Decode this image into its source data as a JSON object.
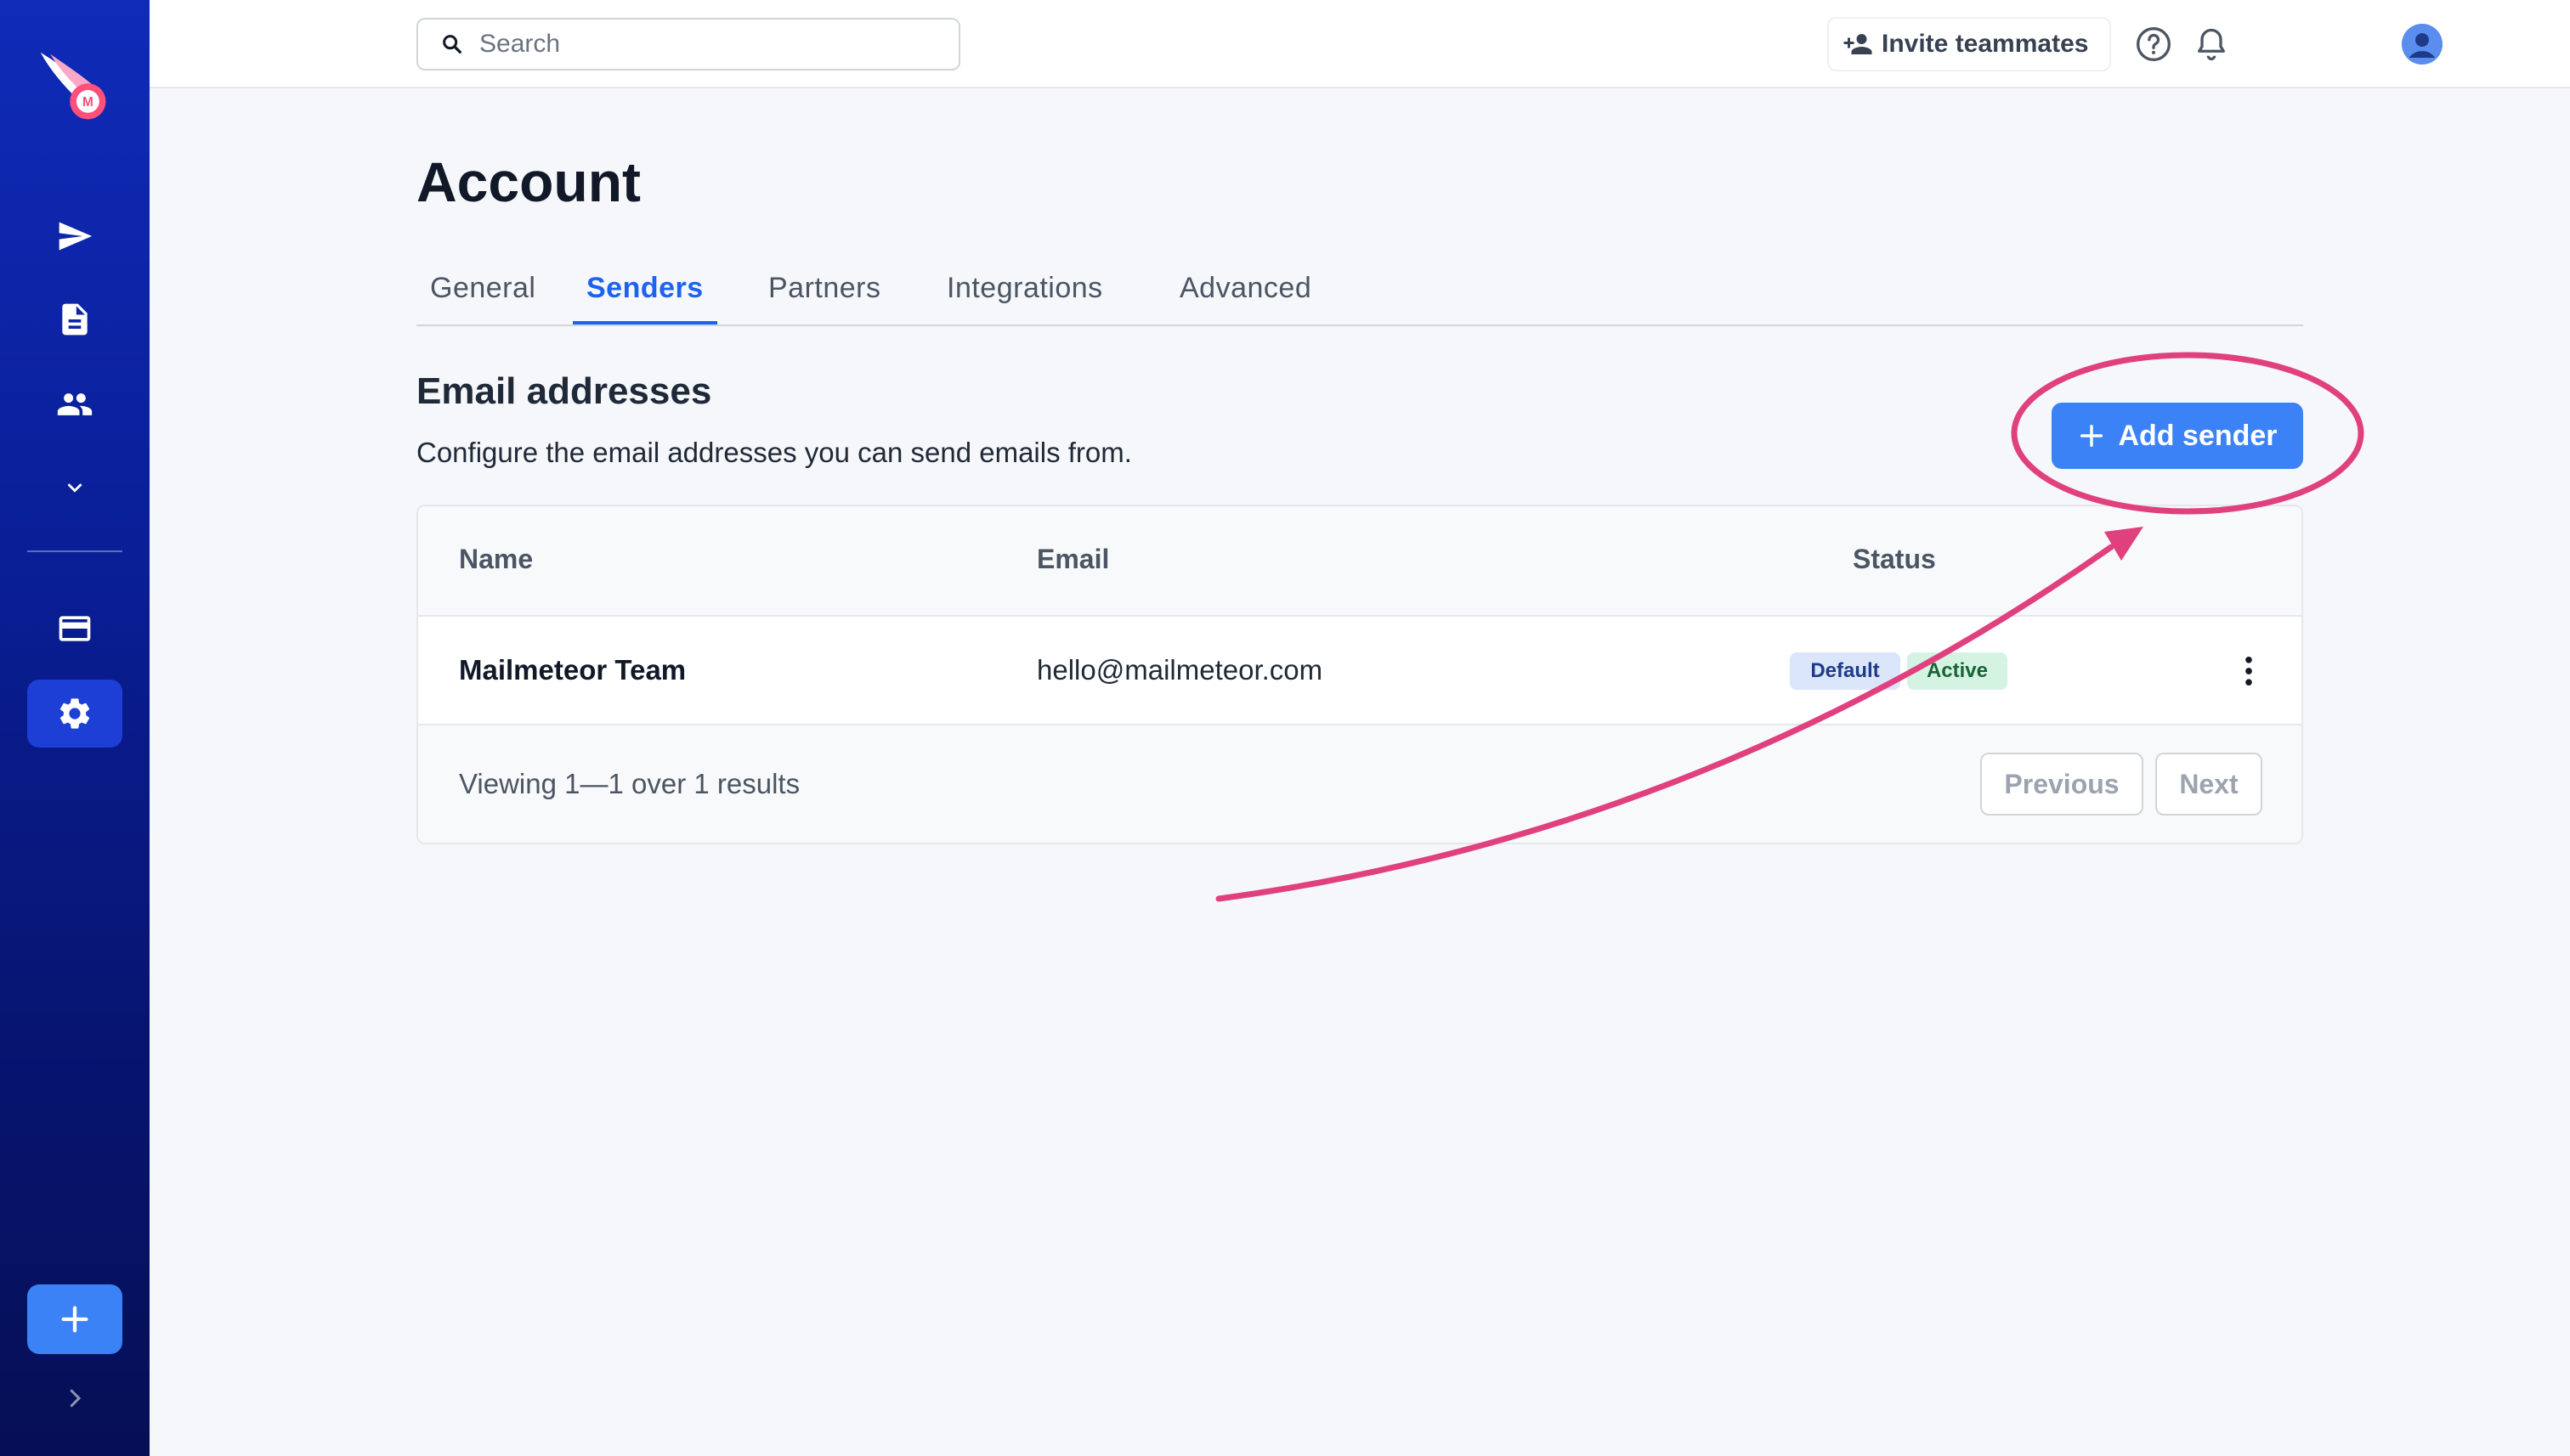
{
  "colors": {
    "sidebar": "#0a1f9a",
    "accent": "#3b82f6",
    "tab_active": "#1d62f0",
    "annotation": "#e0407e"
  },
  "topbar": {
    "search_placeholder": "Search",
    "invite_label": "Invite teammates"
  },
  "sidebar": {
    "items": [
      {
        "icon": "send-icon"
      },
      {
        "icon": "document-icon"
      },
      {
        "icon": "people-icon"
      },
      {
        "icon": "chevron-down-icon"
      },
      {
        "icon": "credit-card-icon"
      },
      {
        "icon": "gear-icon",
        "active": true
      }
    ]
  },
  "page": {
    "title": "Account",
    "tabs": [
      {
        "label": "General"
      },
      {
        "label": "Senders",
        "active": true
      },
      {
        "label": "Partners"
      },
      {
        "label": "Integrations"
      },
      {
        "label": "Advanced"
      }
    ]
  },
  "section": {
    "title": "Email addresses",
    "description": "Configure the email addresses you can send emails from.",
    "add_button": "Add sender"
  },
  "table": {
    "columns": [
      "Name",
      "Email",
      "Status"
    ],
    "rows": [
      {
        "name": "Mailmeteor Team",
        "email": "hello@mailmeteor.com",
        "badges": [
          "Default",
          "Active"
        ]
      }
    ],
    "footer": "Viewing 1—1 over 1 results",
    "prev_label": "Previous",
    "next_label": "Next"
  }
}
